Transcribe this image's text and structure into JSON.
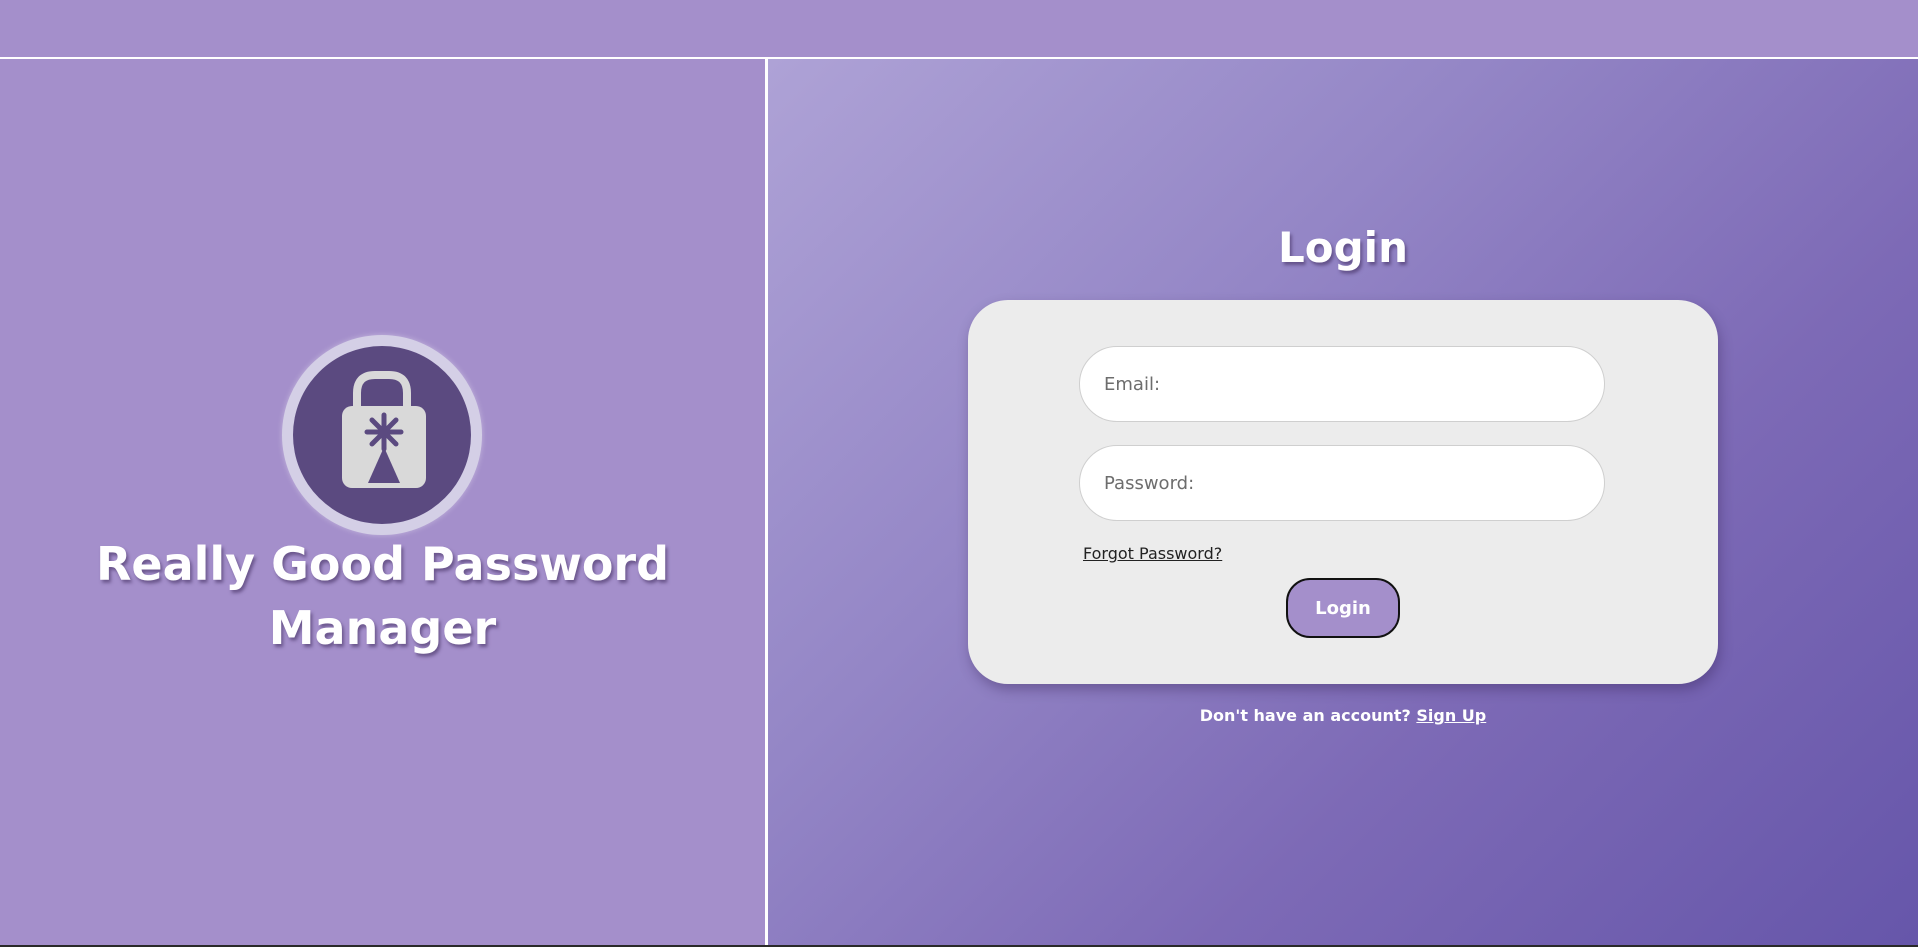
{
  "brand": {
    "title": "Really Good Password Manager",
    "logo_icon": "padlock-icon"
  },
  "login": {
    "heading": "Login",
    "email_placeholder": "Email:",
    "password_placeholder": "Password:",
    "forgot_label": "Forgot Password?",
    "button_label": "Login",
    "signup_prompt": "Don't have an account?",
    "signup_link": "Sign Up"
  },
  "colors": {
    "accent": "#a48fcb",
    "logo_dark": "#5b4a80",
    "card_bg": "#ececec"
  }
}
